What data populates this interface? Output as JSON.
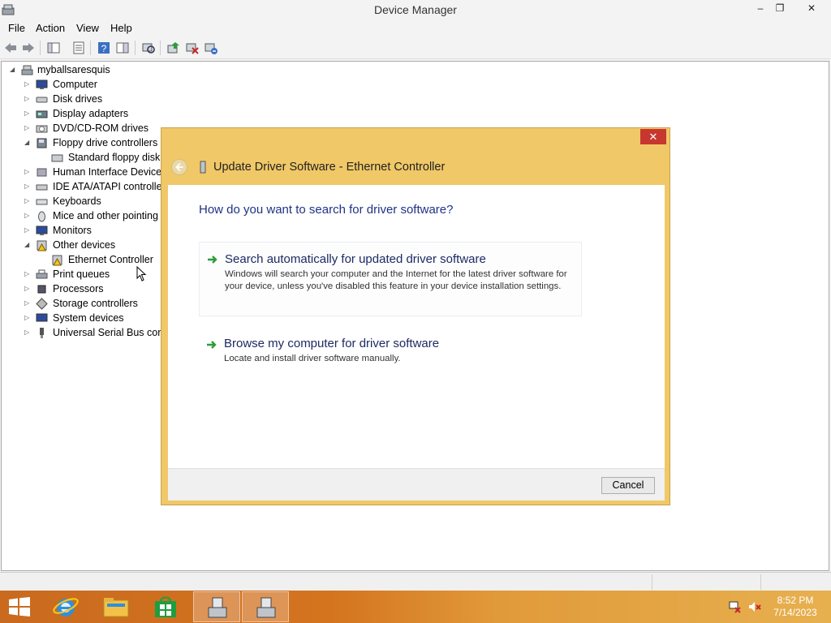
{
  "window": {
    "title": "Device Manager"
  },
  "menu": {
    "file": "File",
    "action": "Action",
    "view": "View",
    "help": "Help"
  },
  "toolbar": {
    "icons": [
      "back-arrow-icon",
      "forward-arrow-icon",
      "show-hide-console-tree-icon",
      "properties-icon",
      "help-icon",
      "action-pane-icon",
      "scan-hardware-icon",
      "update-driver-icon",
      "disable-device-icon",
      "uninstall-device-icon"
    ]
  },
  "tree": {
    "root": "myballsaresquis",
    "computer": "Computer",
    "disk_drives": "Disk drives",
    "display_adapters": "Display adapters",
    "dvd": "DVD/CD-ROM drives",
    "floppy": "Floppy drive controllers",
    "floppy_child": "Standard floppy disk c",
    "hid": "Human Interface Devices",
    "ide": "IDE ATA/ATAPI controller",
    "keyboards": "Keyboards",
    "mice": "Mice and other pointing d",
    "monitors": "Monitors",
    "other": "Other devices",
    "ethernet": "Ethernet Controller",
    "print": "Print queues",
    "processors": "Processors",
    "storage": "Storage controllers",
    "system": "System devices",
    "usb": "Universal Serial Bus contro"
  },
  "dialog": {
    "title": "Update Driver Software - Ethernet Controller",
    "question": "How do you want to search for driver software?",
    "option1": {
      "title": "Search automatically for updated driver software",
      "desc": "Windows will search your computer and the Internet for the latest driver software for your device, unless you've disabled this feature in your device installation settings."
    },
    "option2": {
      "title": "Browse my computer for driver software",
      "desc": "Locate and install driver software manually."
    },
    "cancel": "Cancel",
    "close_glyph": "✕"
  },
  "taskbar": {
    "time": "8:52 PM",
    "date": "7/14/2023"
  },
  "colors": {
    "dialog_frame": "#f0c867",
    "dialog_question": "#1e3287",
    "arrow_green": "#2e9c3a",
    "taskbar": "#d4741f"
  }
}
